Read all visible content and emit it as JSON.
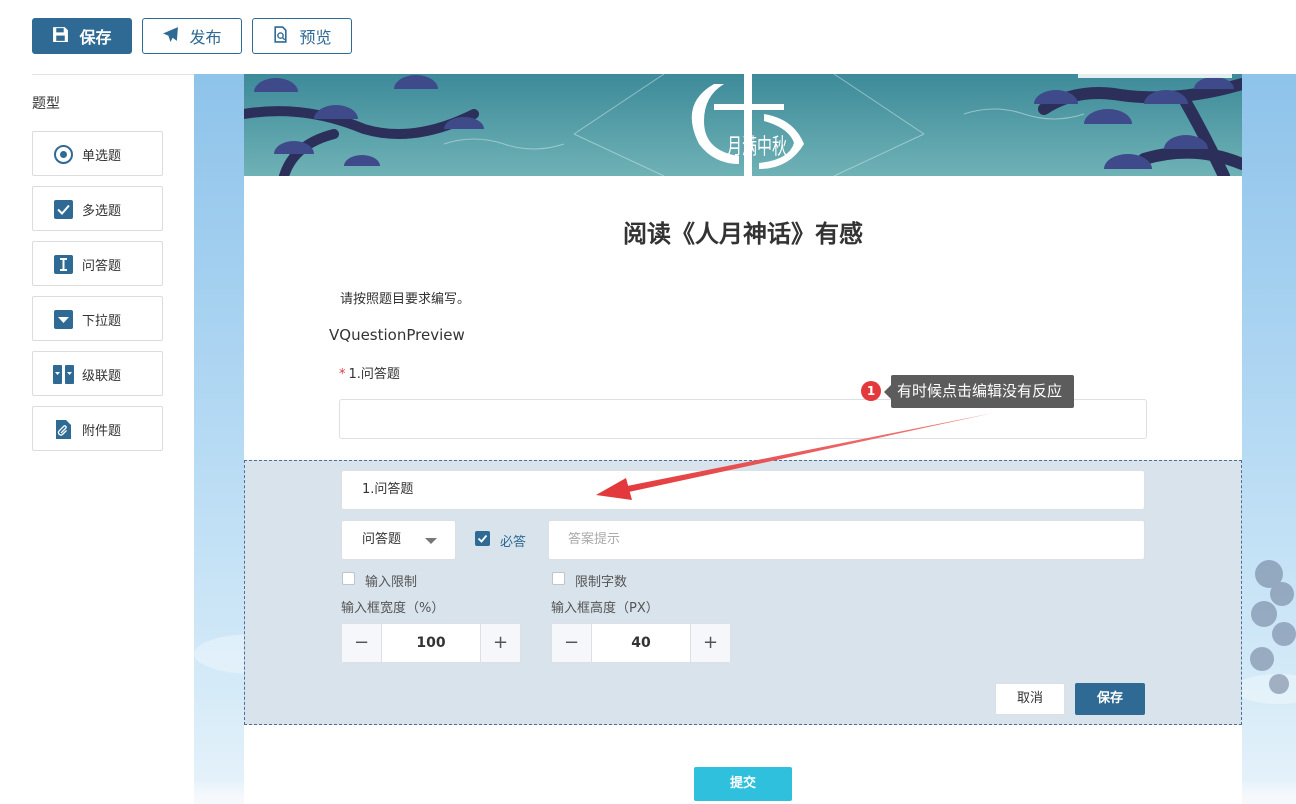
{
  "toolbar": {
    "save_label": "保存",
    "publish_label": "发布",
    "preview_label": "预览"
  },
  "sidebar": {
    "title": "题型",
    "items": [
      {
        "label": "单选题",
        "icon": "radio-icon"
      },
      {
        "label": "多选题",
        "icon": "checkbox-icon"
      },
      {
        "label": "问答题",
        "icon": "text-cursor-icon"
      },
      {
        "label": "下拉题",
        "icon": "dropdown-icon"
      },
      {
        "label": "级联题",
        "icon": "cascade-icon"
      },
      {
        "label": "附件题",
        "icon": "attachment-icon"
      }
    ]
  },
  "banner": {
    "calligraphy": "月满中秋"
  },
  "form": {
    "title": "阅读《人月神话》有感",
    "description": "请按照题目要求编写。",
    "component_tag": "VQuestionPreview",
    "question_label": "1.问答题",
    "required_mark": "*",
    "submit_label": "提交"
  },
  "annotation": {
    "badge": "1",
    "text": "有时候点击编辑没有反应",
    "color": "#e4393c"
  },
  "editor": {
    "title_value": "1.问答题",
    "type_value": "问答题",
    "required_label": "必答",
    "required_checked": true,
    "hint_placeholder": "答案提示",
    "input_limit_label": "输入限制",
    "char_limit_label": "限制字数",
    "width_label": "输入框宽度（%）",
    "height_label": "输入框高度（PX）",
    "width_value": "100",
    "height_value": "40",
    "minus": "−",
    "plus": "+",
    "cancel_label": "取消",
    "save_label": "保存"
  },
  "colors": {
    "primary": "#2e6a93",
    "submit": "#2ec0dc",
    "panel_bg": "#d8e3ec",
    "annotation_red": "#e4393c"
  }
}
